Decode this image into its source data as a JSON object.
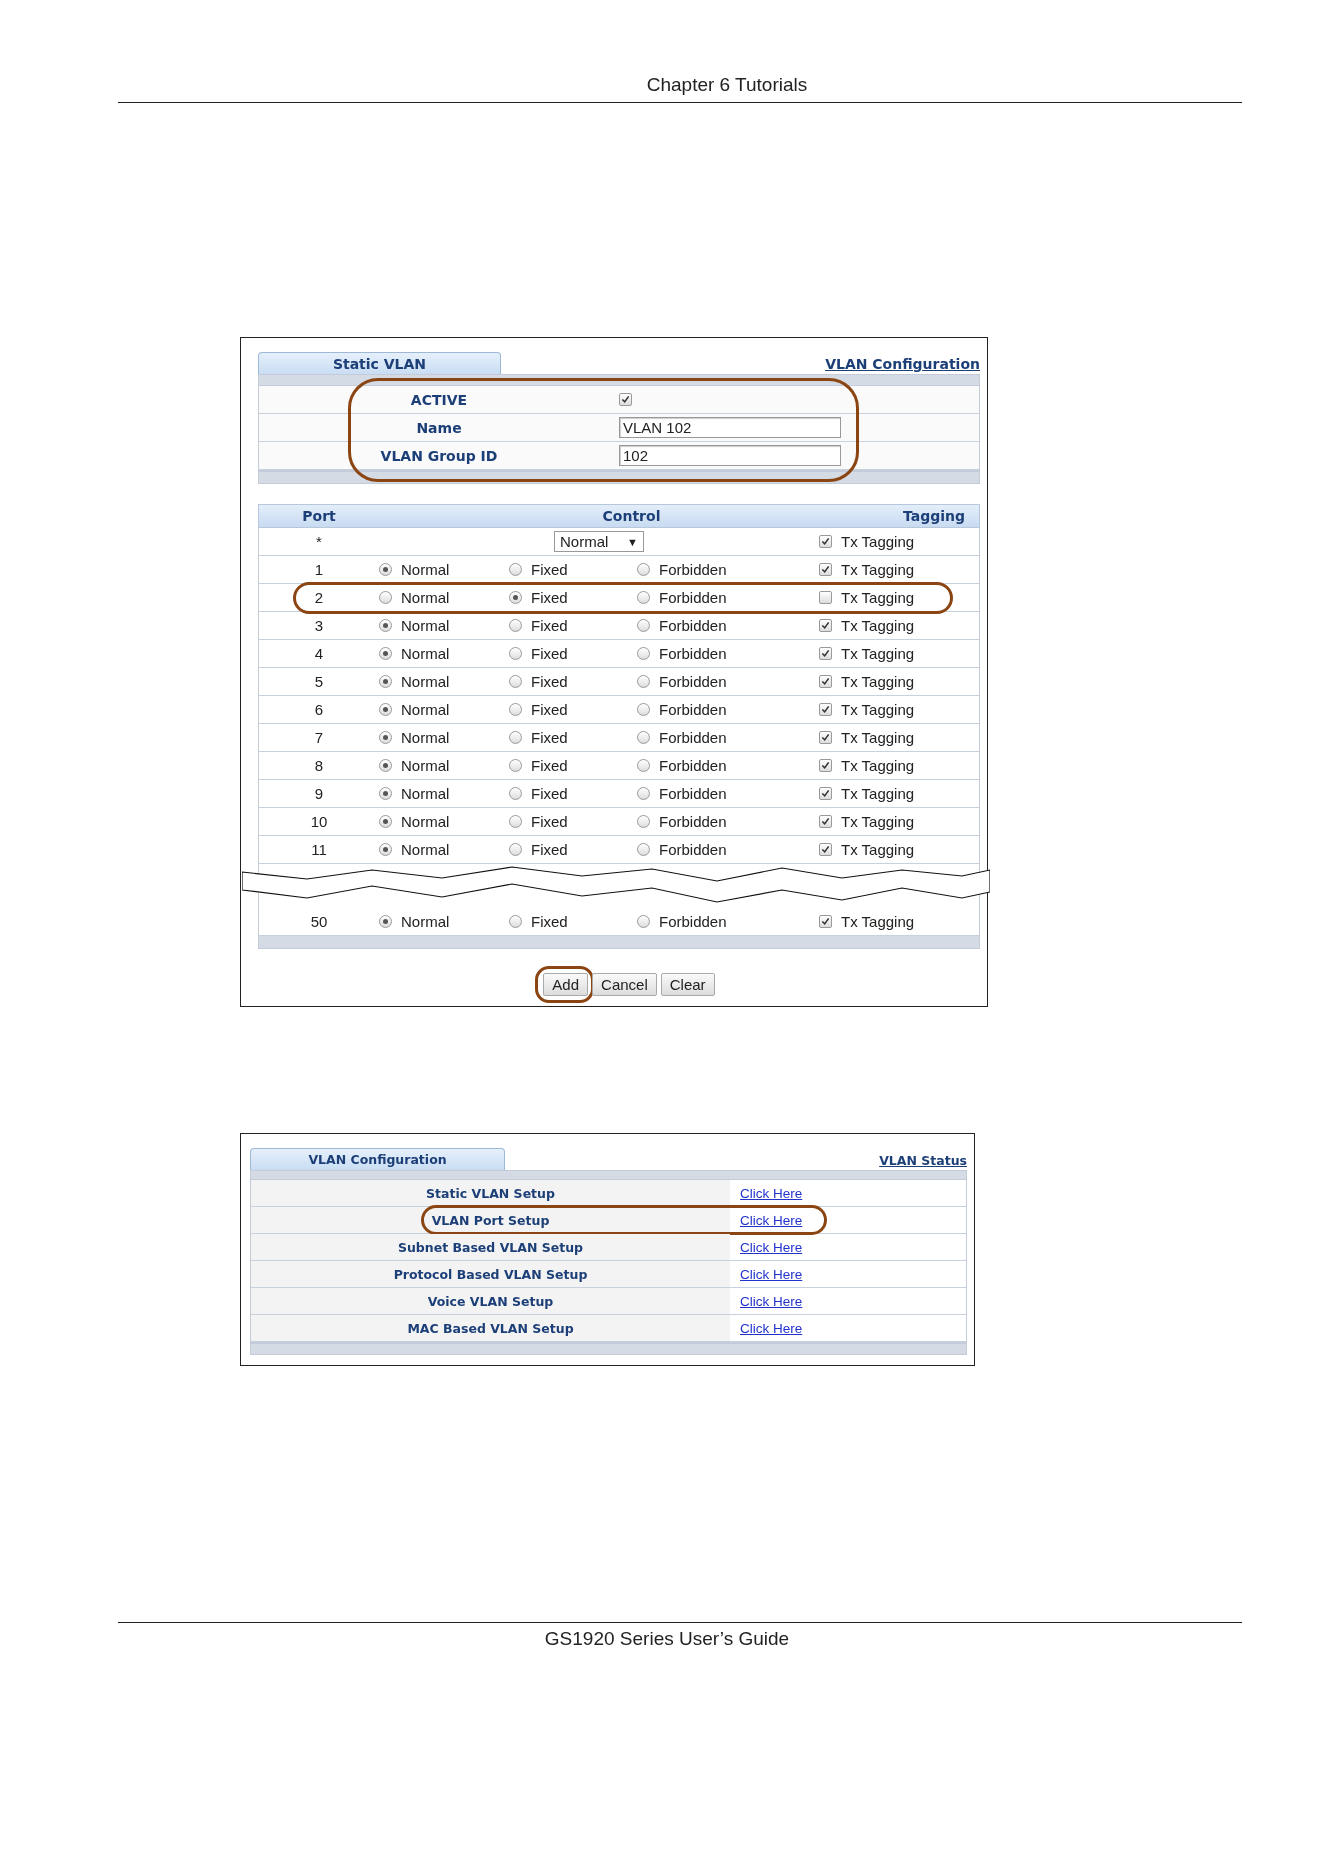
{
  "page_header": "Chapter 6 Tutorials",
  "static_vlan": {
    "tab": {
      "label": "Static VLAN",
      "selected": true
    },
    "link": "VLAN Configuration",
    "settings": {
      "highlighted": true,
      "active": {
        "label": "ACTIVE",
        "checked": true
      },
      "name": {
        "label": "Name",
        "value": "VLAN 102"
      },
      "group_id": {
        "label": "VLAN Group ID",
        "value": "102"
      }
    },
    "ports": {
      "columns": [
        "Port",
        "Control",
        "Tagging"
      ],
      "all_row": {
        "port": "*",
        "control": {
          "value": "Normal",
          "caret": "▼"
        },
        "tagging": {
          "label": "Tx Tagging",
          "checked": true
        }
      },
      "rows": [
        {
          "port": "1",
          "highlighted": false,
          "options": [
            {
              "label": "Normal",
              "selected": true
            },
            {
              "label": "Fixed",
              "selected": false
            },
            {
              "label": "Forbidden",
              "selected": false
            }
          ],
          "tagging": {
            "label": "Tx Tagging",
            "checked": true
          }
        },
        {
          "port": "2",
          "highlighted": true,
          "options": [
            {
              "label": "Normal",
              "selected": false
            },
            {
              "label": "Fixed",
              "selected": true
            },
            {
              "label": "Forbidden",
              "selected": false
            }
          ],
          "tagging": {
            "label": "Tx Tagging",
            "checked": false
          }
        },
        {
          "port": "3",
          "highlighted": false,
          "options": [
            {
              "label": "Normal",
              "selected": true
            },
            {
              "label": "Fixed",
              "selected": false
            },
            {
              "label": "Forbidden",
              "selected": false
            }
          ],
          "tagging": {
            "label": "Tx Tagging",
            "checked": true
          }
        },
        {
          "port": "4",
          "highlighted": false,
          "options": [
            {
              "label": "Normal",
              "selected": true
            },
            {
              "label": "Fixed",
              "selected": false
            },
            {
              "label": "Forbidden",
              "selected": false
            }
          ],
          "tagging": {
            "label": "Tx Tagging",
            "checked": true
          }
        },
        {
          "port": "5",
          "highlighted": false,
          "options": [
            {
              "label": "Normal",
              "selected": true
            },
            {
              "label": "Fixed",
              "selected": false
            },
            {
              "label": "Forbidden",
              "selected": false
            }
          ],
          "tagging": {
            "label": "Tx Tagging",
            "checked": true
          }
        },
        {
          "port": "6",
          "highlighted": false,
          "options": [
            {
              "label": "Normal",
              "selected": true
            },
            {
              "label": "Fixed",
              "selected": false
            },
            {
              "label": "Forbidden",
              "selected": false
            }
          ],
          "tagging": {
            "label": "Tx Tagging",
            "checked": true
          }
        },
        {
          "port": "7",
          "highlighted": false,
          "options": [
            {
              "label": "Normal",
              "selected": true
            },
            {
              "label": "Fixed",
              "selected": false
            },
            {
              "label": "Forbidden",
              "selected": false
            }
          ],
          "tagging": {
            "label": "Tx Tagging",
            "checked": true
          }
        },
        {
          "port": "8",
          "highlighted": false,
          "options": [
            {
              "label": "Normal",
              "selected": true
            },
            {
              "label": "Fixed",
              "selected": false
            },
            {
              "label": "Forbidden",
              "selected": false
            }
          ],
          "tagging": {
            "label": "Tx Tagging",
            "checked": true
          }
        },
        {
          "port": "9",
          "highlighted": false,
          "options": [
            {
              "label": "Normal",
              "selected": true
            },
            {
              "label": "Fixed",
              "selected": false
            },
            {
              "label": "Forbidden",
              "selected": false
            }
          ],
          "tagging": {
            "label": "Tx Tagging",
            "checked": true
          }
        },
        {
          "port": "10",
          "highlighted": false,
          "options": [
            {
              "label": "Normal",
              "selected": true
            },
            {
              "label": "Fixed",
              "selected": false
            },
            {
              "label": "Forbidden",
              "selected": false
            }
          ],
          "tagging": {
            "label": "Tx Tagging",
            "checked": true
          }
        },
        {
          "port": "11",
          "highlighted": false,
          "options": [
            {
              "label": "Normal",
              "selected": true
            },
            {
              "label": "Fixed",
              "selected": false
            },
            {
              "label": "Forbidden",
              "selected": false
            }
          ],
          "tagging": {
            "label": "Tx Tagging",
            "checked": true
          }
        }
      ],
      "last_rows": [
        {
          "port": "50",
          "highlighted": false,
          "options": [
            {
              "label": "Normal",
              "selected": true
            },
            {
              "label": "Fixed",
              "selected": false
            },
            {
              "label": "Forbidden",
              "selected": false
            }
          ],
          "tagging": {
            "label": "Tx Tagging",
            "checked": true
          }
        }
      ]
    },
    "buttons": [
      {
        "label": "Add",
        "highlighted": true
      },
      {
        "label": "Cancel",
        "highlighted": false
      },
      {
        "label": "Clear",
        "highlighted": false
      }
    ]
  },
  "vlan_configuration": {
    "tab": {
      "label": "VLAN Configuration",
      "selected": true
    },
    "link": "VLAN Status",
    "rows": [
      {
        "label": "Static VLAN Setup",
        "link": "Click Here",
        "highlighted": false
      },
      {
        "label": "VLAN Port Setup",
        "link": "Click Here",
        "highlighted": true
      },
      {
        "label": "Subnet Based VLAN Setup",
        "link": "Click Here",
        "highlighted": false
      },
      {
        "label": "Protocol Based VLAN Setup",
        "link": "Click Here",
        "highlighted": false
      },
      {
        "label": "Voice VLAN Setup",
        "link": "Click Here",
        "highlighted": false
      },
      {
        "label": "MAC Based VLAN Setup",
        "link": "Click Here",
        "highlighted": false
      }
    ]
  },
  "page_footer": "GS1920 Series User’s Guide"
}
